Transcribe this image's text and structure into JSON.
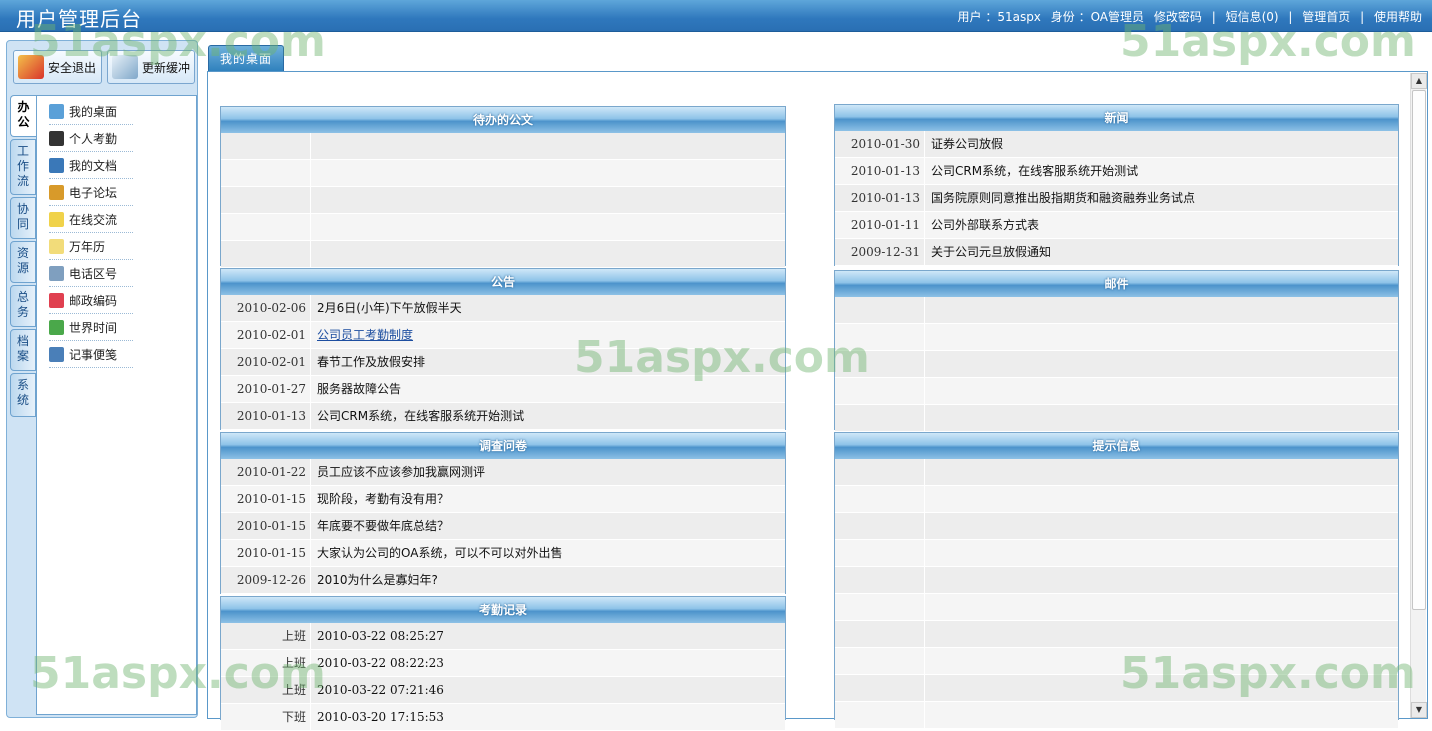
{
  "header": {
    "title": "用户管理后台",
    "user_label": "用户 ：51aspx",
    "role_label": "身份 ：OA管理员",
    "links": [
      "修改密码",
      "短信息(0)",
      "管理首页",
      "使用帮助"
    ],
    "separator": "|"
  },
  "watermark_text": "51aspx.com",
  "sidebar": {
    "buttons": [
      "安全退出",
      "更新缓冲"
    ],
    "vtabs": [
      "办公",
      "工作流",
      "协同",
      "资源",
      "总务",
      "档案",
      "系统"
    ],
    "menu_items": [
      {
        "label": "我的桌面",
        "icon": "desktop-icon",
        "color": "#5aa0d8"
      },
      {
        "label": "个人考勤",
        "icon": "clock-icon",
        "color": "#333333"
      },
      {
        "label": "我的文档",
        "icon": "document-icon",
        "color": "#3a78b8"
      },
      {
        "label": "电子论坛",
        "icon": "forum-icon",
        "color": "#d89a2a"
      },
      {
        "label": "在线交流",
        "icon": "chat-icon",
        "color": "#f0d24a"
      },
      {
        "label": "万年历",
        "icon": "calendar-icon",
        "color": "#f2dc7a"
      },
      {
        "label": "电话区号",
        "icon": "phone-icon",
        "color": "#7f9fbf"
      },
      {
        "label": "邮政编码",
        "icon": "heart-icon",
        "color": "#e04050"
      },
      {
        "label": "世界时间",
        "icon": "globe-icon",
        "color": "#4aa84a"
      },
      {
        "label": "记事便笺",
        "icon": "notepad-icon",
        "color": "#4a7fb8"
      }
    ]
  },
  "main": {
    "tab_label": "我的桌面",
    "panels": {
      "todo": {
        "title": "待办的公文",
        "rows": [
          {
            "d": "",
            "t": ""
          },
          {
            "d": "",
            "t": ""
          },
          {
            "d": "",
            "t": ""
          },
          {
            "d": "",
            "t": ""
          },
          {
            "d": "",
            "t": ""
          }
        ]
      },
      "notice": {
        "title": "公告",
        "rows": [
          {
            "d": "2010-02-06",
            "t": "2月6日(小年)下午放假半天"
          },
          {
            "d": "2010-02-01",
            "t": "公司员工考勤制度"
          },
          {
            "d": "2010-02-01",
            "t": "春节工作及放假安排"
          },
          {
            "d": "2010-01-27",
            "t": "服务器故障公告"
          },
          {
            "d": "2010-01-13",
            "t": "公司CRM系统，在线客服系统开始测试"
          }
        ]
      },
      "survey": {
        "title": "调查问卷",
        "rows": [
          {
            "d": "2010-01-22",
            "t": "员工应该不应该参加我赢网测评"
          },
          {
            "d": "2010-01-15",
            "t": "现阶段，考勤有没有用？"
          },
          {
            "d": "2010-01-15",
            "t": "年底要不要做年底总结？"
          },
          {
            "d": "2010-01-15",
            "t": "大家认为公司的OA系统，可以不可以对外出售"
          },
          {
            "d": "2009-12-26",
            "t": "2010为什么是寡妇年?"
          }
        ]
      },
      "attendance": {
        "title": "考勤记录",
        "rows": [
          {
            "d": "上班",
            "t": "2010-03-22 08:25:27"
          },
          {
            "d": "上班",
            "t": "2010-03-22 08:22:23"
          },
          {
            "d": "上班",
            "t": "2010-03-22 07:21:46"
          },
          {
            "d": "下班",
            "t": "2010-03-20 17:15:53"
          }
        ]
      },
      "news": {
        "title": "新闻",
        "rows": [
          {
            "d": "2010-01-30",
            "t": "证券公司放假"
          },
          {
            "d": "2010-01-13",
            "t": "公司CRM系统，在线客服系统开始测试"
          },
          {
            "d": "2010-01-13",
            "t": "国务院原则同意推出股指期货和融资融券业务试点"
          },
          {
            "d": "2010-01-11",
            "t": "公司外部联系方式表"
          },
          {
            "d": "2009-12-31",
            "t": "关于公司元旦放假通知"
          }
        ]
      },
      "mail": {
        "title": "邮件",
        "rows": [
          {
            "d": "",
            "t": ""
          },
          {
            "d": "",
            "t": ""
          },
          {
            "d": "",
            "t": ""
          },
          {
            "d": "",
            "t": ""
          },
          {
            "d": "",
            "t": ""
          }
        ]
      },
      "tips": {
        "title": "提示信息",
        "rows": [
          {
            "d": "",
            "t": ""
          },
          {
            "d": "",
            "t": ""
          },
          {
            "d": "",
            "t": ""
          },
          {
            "d": "",
            "t": ""
          },
          {
            "d": "",
            "t": ""
          },
          {
            "d": "",
            "t": ""
          },
          {
            "d": "",
            "t": ""
          },
          {
            "d": "",
            "t": ""
          },
          {
            "d": "",
            "t": ""
          },
          {
            "d": "",
            "t": ""
          }
        ]
      }
    }
  }
}
